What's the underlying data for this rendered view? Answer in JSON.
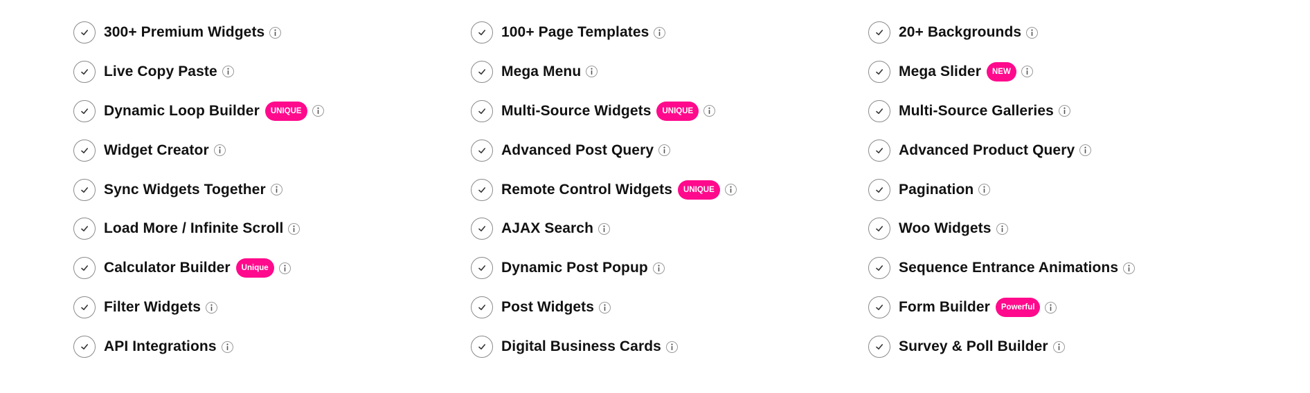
{
  "colors": {
    "badge": "#ff0a8c",
    "text": "#111111",
    "icon_border": "#8a8a8a"
  },
  "icons": {
    "check": "check-circle-icon",
    "info": "info-icon"
  },
  "columns": [
    {
      "items": [
        {
          "label": "300+ Premium Widgets",
          "badge": null
        },
        {
          "label": "Live Copy Paste",
          "badge": null
        },
        {
          "label": "Dynamic Loop Builder",
          "badge": "UNIQUE"
        },
        {
          "label": "Widget Creator",
          "badge": null
        },
        {
          "label": "Sync Widgets Together",
          "badge": null
        },
        {
          "label": "Load More / Infinite Scroll",
          "badge": null
        },
        {
          "label": "Calculator Builder",
          "badge": "Unique"
        },
        {
          "label": "Filter Widgets",
          "badge": null
        },
        {
          "label": "API Integrations",
          "badge": null
        }
      ]
    },
    {
      "items": [
        {
          "label": "100+ Page Templates",
          "badge": null
        },
        {
          "label": "Mega Menu",
          "badge": null
        },
        {
          "label": "Multi-Source Widgets",
          "badge": "UNIQUE"
        },
        {
          "label": "Advanced Post Query",
          "badge": null
        },
        {
          "label": "Remote Control Widgets",
          "badge": "UNIQUE"
        },
        {
          "label": "AJAX Search",
          "badge": null
        },
        {
          "label": "Dynamic Post Popup",
          "badge": null
        },
        {
          "label": "Post Widgets",
          "badge": null
        },
        {
          "label": "Digital Business Cards",
          "badge": null
        }
      ]
    },
    {
      "items": [
        {
          "label": "20+ Backgrounds",
          "badge": null
        },
        {
          "label": "Mega Slider",
          "badge": "NEW"
        },
        {
          "label": "Multi-Source Galleries",
          "badge": null
        },
        {
          "label": "Advanced Product Query",
          "badge": null
        },
        {
          "label": "Pagination",
          "badge": null
        },
        {
          "label": "Woo Widgets",
          "badge": null
        },
        {
          "label": "Sequence Entrance Animations",
          "badge": null
        },
        {
          "label": "Form Builder",
          "badge": "Powerful"
        },
        {
          "label": "Survey & Poll Builder",
          "badge": null
        }
      ]
    }
  ]
}
